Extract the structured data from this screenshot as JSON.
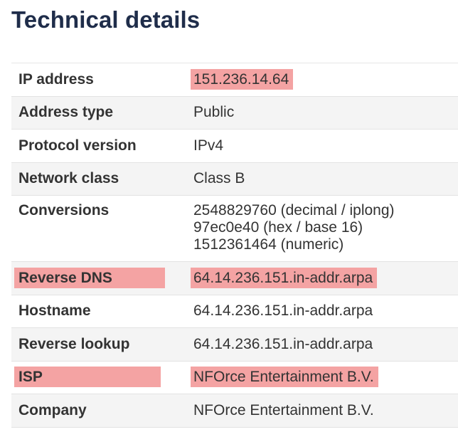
{
  "heading": "Technical details",
  "rows": [
    {
      "label": "IP address",
      "value": "151.236.14.64"
    },
    {
      "label": "Address type",
      "value": "Public"
    },
    {
      "label": "Protocol version",
      "value": "IPv4"
    },
    {
      "label": "Network class",
      "value": "Class B"
    },
    {
      "label": "Conversions",
      "values": [
        "2548829760 (decimal / iplong)",
        "97ec0e40 (hex / base 16)",
        "1512361464 (numeric)"
      ]
    },
    {
      "label": "Reverse DNS",
      "value": "64.14.236.151.in-addr.arpa"
    },
    {
      "label": "Hostname",
      "value": "64.14.236.151.in-addr.arpa"
    },
    {
      "label": "Reverse lookup",
      "value": "64.14.236.151.in-addr.arpa"
    },
    {
      "label": "ISP",
      "value": "NFOrce Entertainment B.V."
    },
    {
      "label": "Company",
      "value": "NFOrce Entertainment B.V."
    }
  ],
  "highlight_color": "#f4a3a3"
}
